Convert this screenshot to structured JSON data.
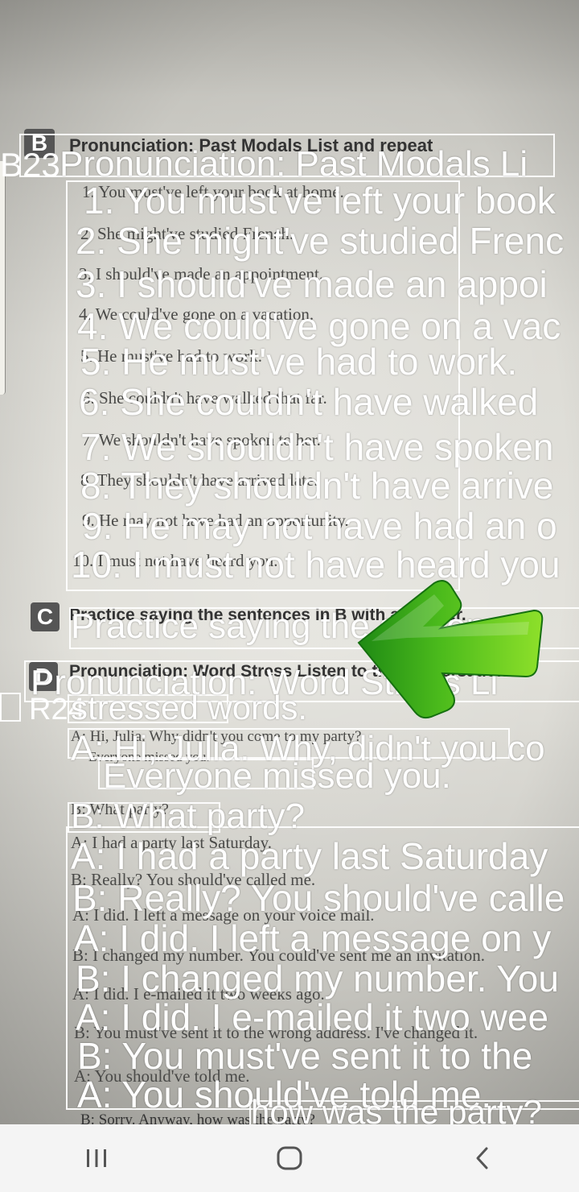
{
  "printed": {
    "b_heading": "Pronunciation: Past Modals List and repeat",
    "b_letter": "B",
    "b_lines": [
      "1. You must've left your book at home.",
      "2. She might've studied French.",
      "3. I should've made an appointment.",
      "4. We could've gone on a vacation.",
      "5. He must've had to work.",
      "6. She couldn't have walked that far.",
      "7. We shouldn't have spoken to her.",
      "8. They shouldn't have arrived late.",
      "9. He may not have had an opportunity.",
      "10. I must not have heard you."
    ],
    "c_letter": "C",
    "c_heading": "Practice saying the sentences in B with a partner.",
    "d_letter": "D",
    "d_heading": "Pronunciation: Word Stress Listen to the conversation.",
    "d_dialog": [
      "A: Hi, Julia. Why didn't you come to my party?",
      "Everyone missed you.",
      "B: What party?",
      "A: I had a party last Saturday.",
      "B: Really? You should've called me.",
      "A: I did. I left a message on your voice mail.",
      "B: I changed my number. You could've sent me an invitation.",
      "A: I did. I e-mailed it two weeks ago.",
      "B: You must've sent it to the wrong address. I've changed it.",
      "A: You should've told me.",
      "B: Sorry. Anyway, how was the party?"
    ]
  },
  "overlay": {
    "header_b": {
      "num": "B23",
      "title": "Pronunciation: Past Modals Li"
    },
    "lines_b": [
      "1. You must've left your book",
      "2. She might've studied Frenc",
      "3. I should've made an appoi",
      "4. We could've gone on a vac",
      "5. He must've had to work.",
      "6. She couldn't have walked",
      "7. We shouldn't have spoken",
      "8. They shouldn't have arrive",
      "9. He may not have had an o",
      "10. I must not have heard you"
    ],
    "practice": "Practice saying the sentences",
    "header_d": {
      "num": "R24",
      "title": "Pronunciation: Word Stress Li"
    },
    "stressed": "stressed words.",
    "dialog_a1": "A: Hi, Julia. Why, didn't you co",
    "dialog_everyone": "Everyone missed you.",
    "dialog_b1": "B: What party?",
    "dialog": [
      "A: I had a party last Saturday",
      "B: Really? You should've calle",
      "A: I did. I left a message on y",
      "B: I changed my number. You",
      "A: I did. I e-mailed it two wee",
      "B: You must've sent it to the",
      "A: You should've told me."
    ],
    "last_line": "how was the party?"
  },
  "nav": {
    "recent": "recent-apps-icon",
    "home": "home-icon",
    "back": "back-icon"
  },
  "colors": {
    "overlay_text": "#ffffff",
    "arrow_green_light": "#8ee02a",
    "arrow_green_dark": "#1f8a14",
    "navbar_bg": "#f4f4f4"
  }
}
